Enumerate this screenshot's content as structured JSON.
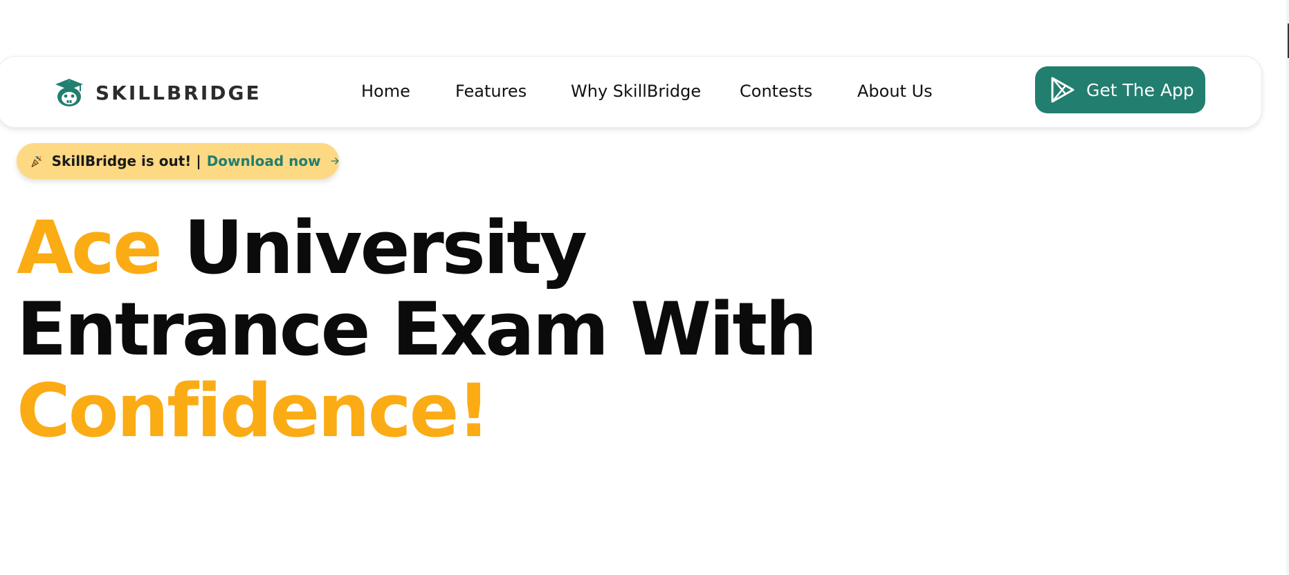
{
  "colors": {
    "brand_green": "#227e6f",
    "accent_orange": "#fbab14",
    "banner_yellow": "#fed983",
    "text_dark": "#0b0b0b"
  },
  "brand": {
    "name": "SKILLBRIDGE",
    "logo_icon": "graduation-cap-mascot-icon"
  },
  "nav": {
    "items": [
      {
        "label": "Home"
      },
      {
        "label": "Features"
      },
      {
        "label": "Why SkillBridge"
      },
      {
        "label": "Contests"
      },
      {
        "label": "About Us"
      }
    ]
  },
  "cta": {
    "label": "Get The App",
    "icon": "play-store-icon"
  },
  "announcement": {
    "icon": "party-popper-icon",
    "text": "SkillBridge is out! |",
    "link": "Download now",
    "arrow_icon": "arrow-right-icon"
  },
  "hero": {
    "line1_accent": "Ace",
    "line1_rest": "University",
    "line2": "Entrance Exam With",
    "line3_accent": "Confidence!"
  }
}
